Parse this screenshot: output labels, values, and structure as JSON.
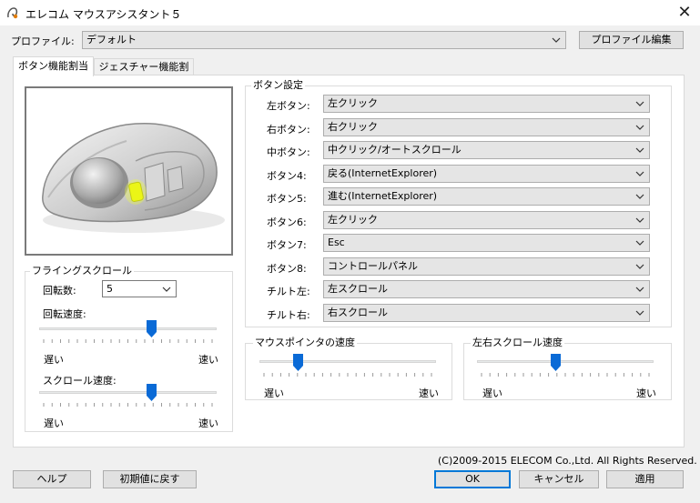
{
  "window": {
    "title": "エレコム マウスアシスタント５",
    "close_glyph": "✕"
  },
  "profile": {
    "label": "プロファイル:",
    "value": "デフォルト",
    "edit_button": "プロファイル編集"
  },
  "tabs": [
    {
      "label": "ボタン機能割当",
      "active": true
    },
    {
      "label": "ジェスチャー機能割当",
      "active": false
    }
  ],
  "button_settings": {
    "group_title": "ボタン設定",
    "rows": [
      {
        "label": "左ボタン:",
        "value": "左クリック"
      },
      {
        "label": "右ボタン:",
        "value": "右クリック"
      },
      {
        "label": "中ボタン:",
        "value": "中クリック/オートスクロール"
      },
      {
        "label": "ボタン4:",
        "value": "戻る(InternetExplorer)"
      },
      {
        "label": "ボタン5:",
        "value": "進む(InternetExplorer)"
      },
      {
        "label": "ボタン6:",
        "value": "左クリック"
      },
      {
        "label": "ボタン7:",
        "value": "Esc"
      },
      {
        "label": "ボタン8:",
        "value": "コントロールパネル"
      },
      {
        "label": "チルト左:",
        "value": "左スクロール"
      },
      {
        "label": "チルト右:",
        "value": "右スクロール"
      }
    ]
  },
  "flying_scroll": {
    "group_title": "フライングスクロール",
    "rotation_count_label": "回転数:",
    "rotation_count_value": "5",
    "rotation_speed_label": "回転速度:",
    "rotation_speed_level": 0.64,
    "rotation_slow": "遅い",
    "rotation_fast": "速い",
    "scroll_speed_label": "スクロール速度:",
    "scroll_speed_level": 0.64,
    "scroll_slow": "遅い",
    "scroll_fast": "速い"
  },
  "pointer_speed": {
    "group_title": "マウスポインタの速度",
    "level": 0.2,
    "slow": "遅い",
    "fast": "速い"
  },
  "hscroll_speed": {
    "group_title": "左右スクロール速度",
    "level": 0.44,
    "slow": "遅い",
    "fast": "速い"
  },
  "copyright": "(C)2009-2015 ELECOM Co.,Ltd. All Rights Reserved.",
  "footer": {
    "help": "ヘルプ",
    "reset": "初期値に戻す",
    "ok": "OK",
    "cancel": "キャンセル",
    "apply": "適用"
  },
  "colors": {
    "accent": "#0078d7",
    "highlight": "#e8f000",
    "thumb": "#0a6ad6"
  },
  "icons": {
    "combo_arrow": "chevron-down-icon",
    "app": "elecom-app-icon"
  }
}
